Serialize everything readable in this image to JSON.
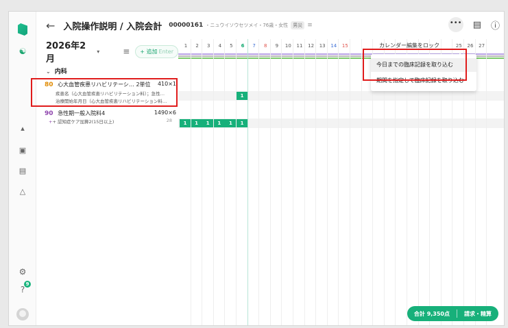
{
  "header": {
    "back_icon": "arrow-left-icon",
    "title": "入院操作説明 / 入院会計",
    "patient_id": "00000161",
    "patient_info": "・ニュウイソウセツメイ・76歳・女性",
    "tag": "男災",
    "more_label": "•••"
  },
  "toolbar": {
    "month": "2026年2月",
    "add_label": "+ 追加",
    "add_shortcut": "Enter"
  },
  "calendar": {
    "days": [
      "1",
      "2",
      "3",
      "4",
      "5",
      "6",
      "7",
      "8",
      "9",
      "10",
      "11",
      "12",
      "13",
      "14",
      "15",
      "",
      "",
      "",
      "",
      "",
      "",
      "",
      "",
      "",
      "25",
      "26",
      "27"
    ],
    "menu_lock_label": "カレンダー編集をロック"
  },
  "list": {
    "department": "内科",
    "items": [
      {
        "score": "80",
        "name": "心大血管疾患リハビリテーシ… 2単位",
        "points": "410×1",
        "sub1": "疾患名（心大血管疾患リハビリテーション料）；急性…",
        "sub2": "治療開始年月日（心大血管疾患リハビリテーション料…"
      },
      {
        "score": "90",
        "name": "急性期一般入院料4",
        "points": "1490×6",
        "sub1": "+ 認知症ケア加算2(15日以上)",
        "sub1_points": "28"
      }
    ],
    "cell_value": "1"
  },
  "menu": {
    "items": [
      "今日までの臨床記録を取り込む",
      "期間を指定して臨床記録を取り込む"
    ]
  },
  "footer": {
    "total": "合計 9,350点",
    "action": "請求・精算"
  },
  "rail": {
    "notification_count": "9"
  },
  "colors": {
    "accent": "#17b07a",
    "highlight_red": "#e01b1b",
    "score_orange": "#e08a00",
    "score_purple": "#8e44ad"
  }
}
